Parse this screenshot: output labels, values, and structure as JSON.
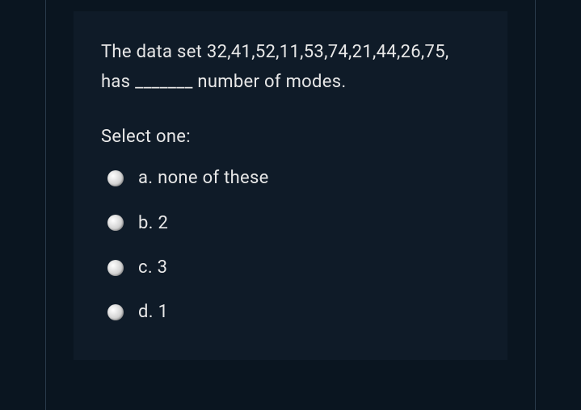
{
  "question": {
    "text": "The data set 32,41,52,11,53,74,21,44,26,75, has _______ number of modes."
  },
  "selectLabel": "Select one:",
  "options": [
    {
      "label": "a. none of these"
    },
    {
      "label": "b. 2"
    },
    {
      "label": "c. 3"
    },
    {
      "label": "d. 1"
    }
  ]
}
